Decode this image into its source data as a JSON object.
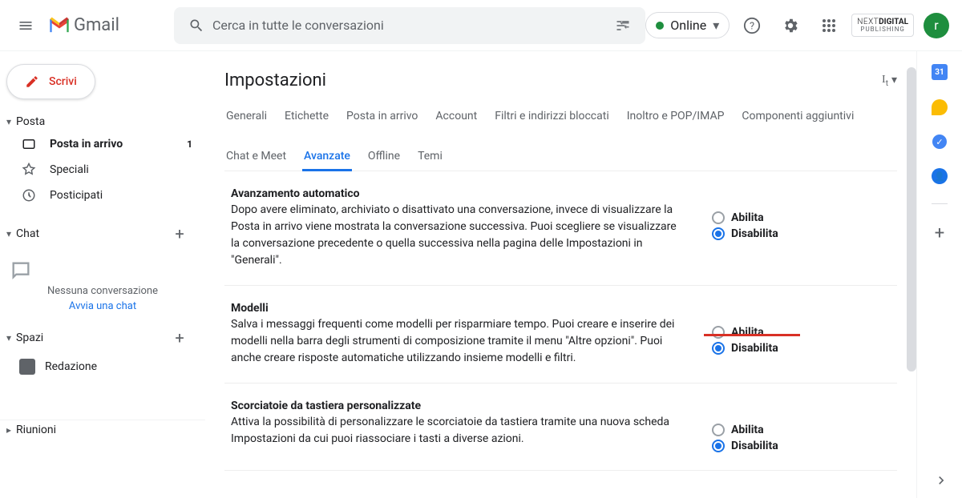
{
  "header": {
    "app_name": "Gmail",
    "search_placeholder": "Cerca in tutte le conversazioni",
    "status": "Online",
    "org": {
      "line1a": "NEXT",
      "line1b": "DIGITAL",
      "line2": "PUBLISHING"
    },
    "avatar_letter": "r"
  },
  "sidebar": {
    "compose_label": "Scrivi",
    "mail_section": "Posta",
    "items": [
      {
        "label": "Posta in arrivo",
        "badge": "1"
      },
      {
        "label": "Speciali"
      },
      {
        "label": "Posticipati"
      }
    ],
    "chat_section": "Chat",
    "chat_empty": "Nessuna conversazione",
    "chat_link": "Avvia una chat",
    "spaces_section": "Spazi",
    "space_item": "Redazione",
    "meet_section": "Riunioni"
  },
  "content": {
    "title": "Impostazioni",
    "tabs": [
      "Generali",
      "Etichette",
      "Posta in arrivo",
      "Account",
      "Filtri e indirizzi bloccati",
      "Inoltro e POP/IMAP",
      "Componenti aggiuntivi",
      "Chat e Meet",
      "Avanzate",
      "Offline",
      "Temi"
    ],
    "active_tab": "Avanzate",
    "radio_enable": "Abilita",
    "radio_disable": "Disabilita",
    "settings": [
      {
        "title": "Avanzamento automatico",
        "desc": "Dopo avere eliminato, archiviato o disattivato una conversazione, invece di visualizzare la Posta in arrivo viene mostrata la conversazione successiva. Puoi scegliere se visualizzare la conversazione precedente o quella successiva nella pagina delle Impostazioni in \"Generali\".",
        "selected": "disable",
        "highlighted": false
      },
      {
        "title": "Modelli",
        "desc": "Salva i messaggi frequenti come modelli per risparmiare tempo. Puoi creare e inserire dei modelli nella barra degli strumenti di composizione tramite il menu \"Altre opzioni\". Puoi anche creare risposte automatiche utilizzando insieme modelli e filtri.",
        "selected": "disable",
        "highlighted": true
      },
      {
        "title": "Scorciatoie da tastiera personalizzate",
        "desc": "Attiva la possibilità di personalizzare le scorciatoie da tastiera tramite una nuova scheda Impostazioni da cui puoi riassociare i tasti a diverse azioni.",
        "selected": "disable",
        "highlighted": false
      }
    ]
  }
}
